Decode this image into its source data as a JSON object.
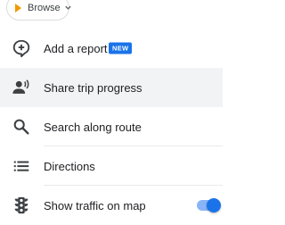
{
  "browse": {
    "label": "Browse"
  },
  "menu": [
    {
      "label": "Add a report",
      "icon": "add-report-icon",
      "badge": "NEW"
    },
    {
      "label": "Share trip progress",
      "icon": "share-trip-icon"
    },
    {
      "label": "Search along route",
      "icon": "search-icon"
    },
    {
      "label": "Directions",
      "icon": "list-icon"
    },
    {
      "label": "Show traffic on map",
      "icon": "traffic-light-icon",
      "toggle_on": true
    }
  ],
  "colors": {
    "accent": "#1a73e8",
    "toggle_track": "#8ab4f8",
    "browse_icon": "#f29900"
  }
}
